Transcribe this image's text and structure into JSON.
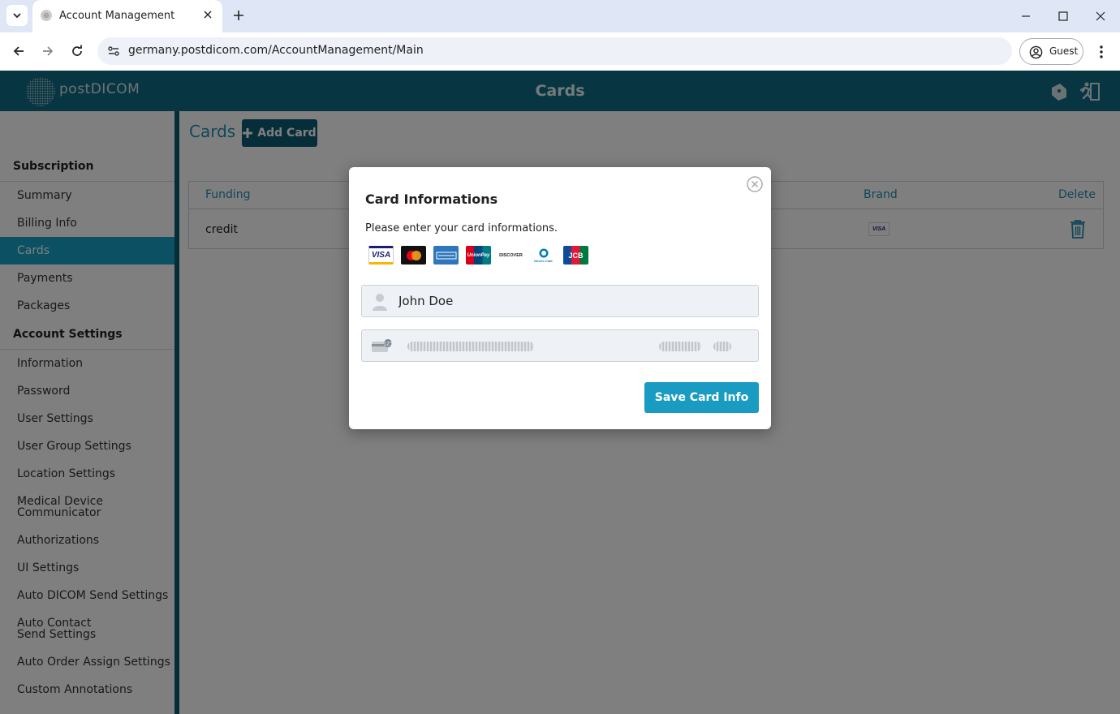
{
  "browser": {
    "tab_title": "Account Management",
    "url": "germany.postdicom.com/AccountManagement/Main",
    "profile_label": "Guest"
  },
  "header": {
    "logo_text": "postDICOM",
    "title": "Cards"
  },
  "sidebar": {
    "sections": [
      {
        "heading": "Subscription",
        "items": [
          "Summary",
          "Billing Info",
          "Cards",
          "Payments",
          "Packages"
        ]
      },
      {
        "heading": "Account Settings",
        "items": [
          "Information",
          "Password",
          "User Settings",
          "User Group Settings",
          "Location Settings",
          "Medical Device Communicator",
          "Authorizations",
          "UI Settings",
          "Auto DICOM Send Settings",
          "Auto Contact Send Settings",
          "Auto Order Assign Settings",
          "Custom Annotations"
        ]
      }
    ],
    "active_item": "Cards"
  },
  "content": {
    "title": "Cards",
    "add_card_label": "Add Card",
    "table": {
      "columns": [
        "Funding",
        "Brand",
        "Delete"
      ],
      "rows": [
        {
          "funding": "credit",
          "brand": "VISA"
        }
      ]
    }
  },
  "modal": {
    "title": "Card Informations",
    "subtitle": "Please enter your card informations.",
    "brands": [
      "VISA",
      "Mastercard",
      "American Express",
      "UnionPay",
      "DISCOVER",
      "Diners Club",
      "JCB"
    ],
    "name_value": "John Doe",
    "save_label": "Save Card Info"
  },
  "colors": {
    "header_bg": "#0e6d85",
    "accent": "#1e8fae",
    "sidebar_active": "#18a3c7",
    "add_card_btn": "#0d5d74",
    "save_btn": "#1a9bc2"
  }
}
